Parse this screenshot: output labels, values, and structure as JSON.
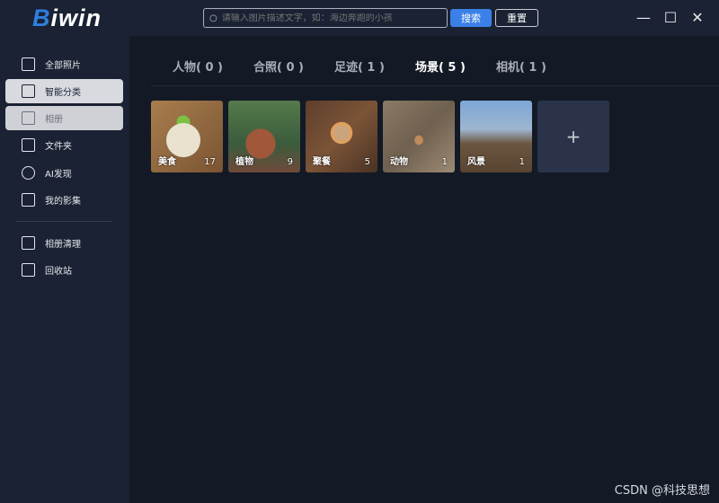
{
  "app": {
    "logo": "Biwin"
  },
  "search": {
    "placeholder": "请输入图片描述文字，如：海边奔跑的小孩",
    "button": "搜索",
    "reset": "重置"
  },
  "window": {
    "minimize": "—",
    "maximize": "☐",
    "close": "✕"
  },
  "sidebar": {
    "items": [
      {
        "label": "全部照片"
      },
      {
        "label": "智能分类"
      },
      {
        "label": "相册"
      },
      {
        "label": "文件夹"
      },
      {
        "label": "AI发现"
      },
      {
        "label": "我的影集"
      },
      {
        "label": "相册清理"
      },
      {
        "label": "回收站"
      }
    ]
  },
  "tabs": [
    {
      "label": "人物( 0 )"
    },
    {
      "label": "合照( 0 )"
    },
    {
      "label": "足迹( 1 )"
    },
    {
      "label": "场景( 5 )"
    },
    {
      "label": "相机( 1 )"
    }
  ],
  "tiles": [
    {
      "label": "美食",
      "count": "17"
    },
    {
      "label": "植物",
      "count": "9"
    },
    {
      "label": "聚餐",
      "count": "5"
    },
    {
      "label": "动物",
      "count": "1"
    },
    {
      "label": "风景",
      "count": "1"
    }
  ],
  "add_label": "+",
  "watermark": "CSDN @科技思想"
}
